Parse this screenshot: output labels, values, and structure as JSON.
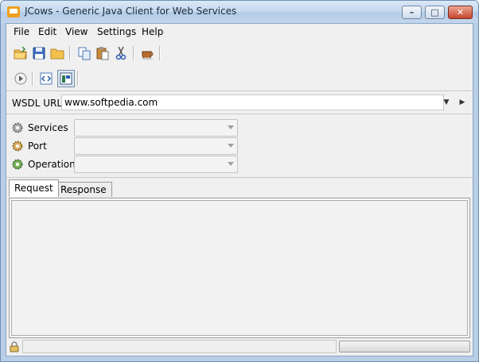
{
  "window": {
    "title": "JCows - Generic Java Client for Web Services",
    "controls": {
      "minimize": "–",
      "maximize": "□",
      "close": "✕"
    }
  },
  "menu": {
    "items": [
      "File",
      "Edit",
      "View",
      "Settings",
      "Help"
    ]
  },
  "toolbar": {
    "row1": [
      "open-folder-icon",
      "save-icon",
      "folder-icon",
      "copy-icon",
      "paste-icon",
      "cut-icon",
      "coffee-cup-icon"
    ],
    "row2": [
      "play-icon",
      "source-view-icon",
      "panel-view-icon"
    ]
  },
  "wsdl": {
    "label": "WSDL URL:",
    "value": "www.softpedia.com",
    "history_arrow": "▼",
    "go_arrow": "▶"
  },
  "fields": [
    {
      "label": "Services",
      "value": ""
    },
    {
      "label": "Port",
      "value": ""
    },
    {
      "label": "Operation",
      "value": ""
    }
  ],
  "tabs": [
    {
      "label": "Request",
      "active": true
    },
    {
      "label": "Response",
      "active": false
    }
  ],
  "status": {
    "text": ""
  },
  "colors": {
    "titlebar": "#c4d8ee",
    "close_button": "#c8452b",
    "panel_bg": "#f0f0f0"
  }
}
